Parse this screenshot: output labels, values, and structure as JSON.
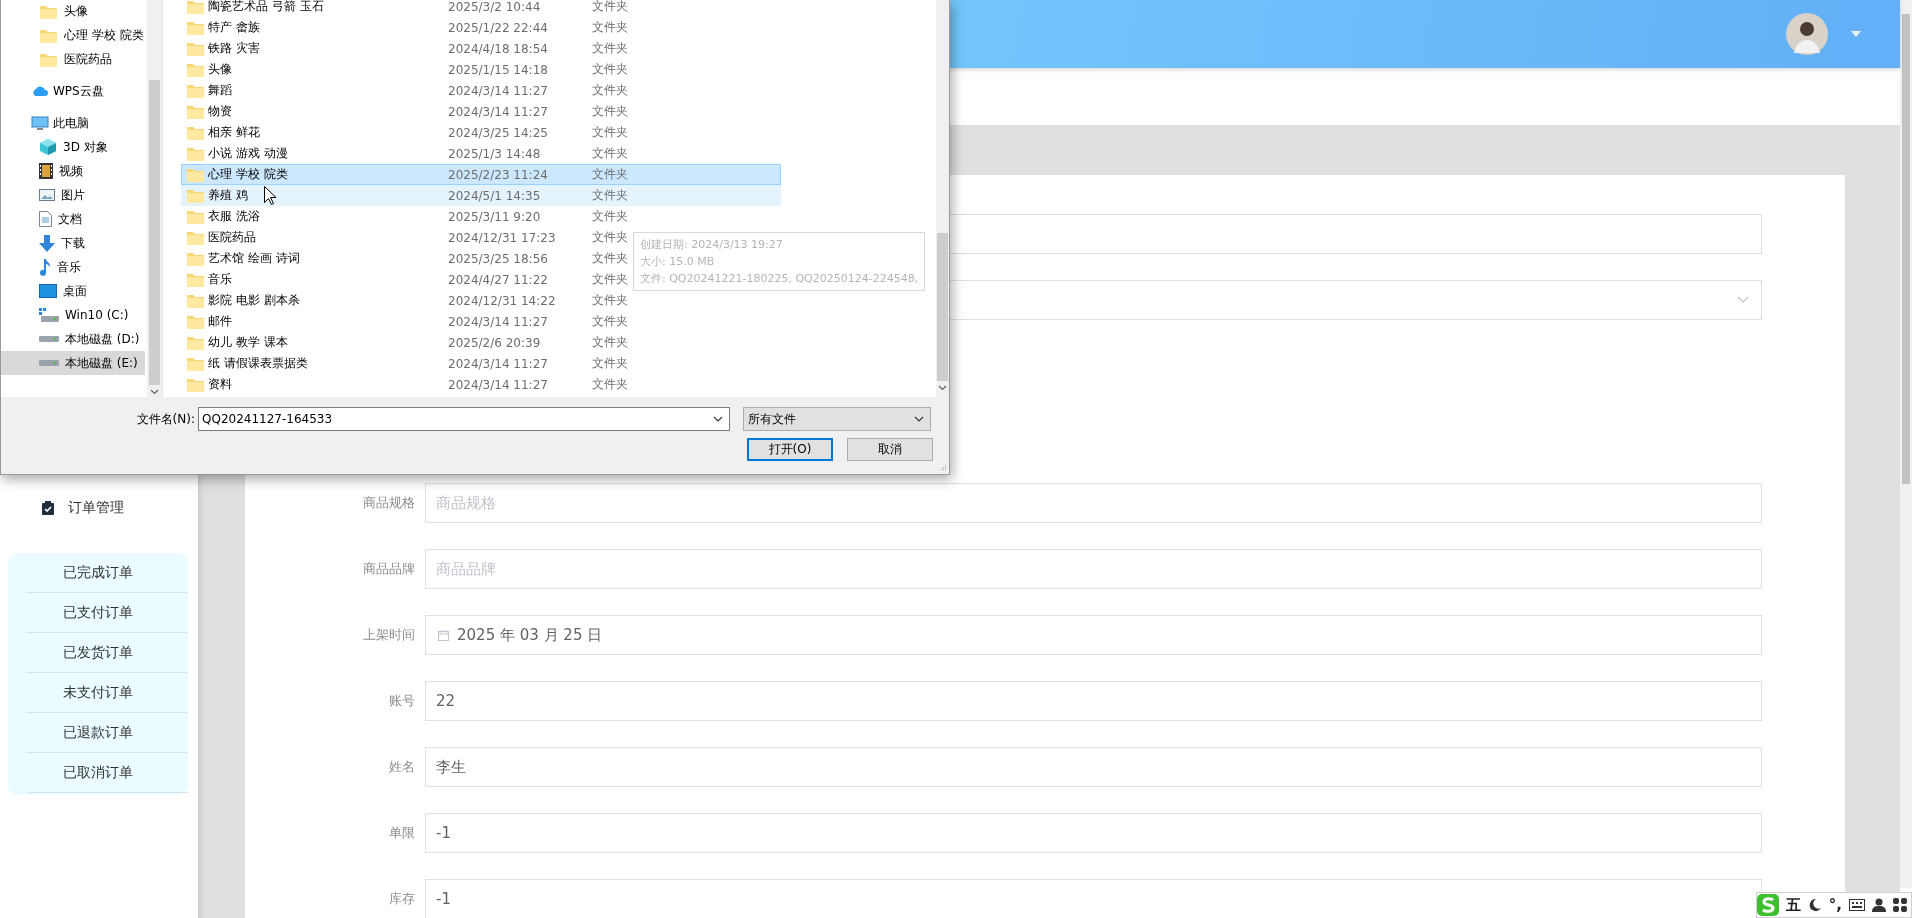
{
  "sidebar": {
    "items": [
      {
        "label": "订单管理",
        "children": [
          {
            "label": "已完成订单"
          },
          {
            "label": "已支付订单"
          },
          {
            "label": "已发货订单"
          },
          {
            "label": "未支付订单"
          },
          {
            "label": "已退款订单"
          },
          {
            "label": "已取消订单"
          }
        ]
      }
    ]
  },
  "form": {
    "fields": [
      {
        "kind": "input"
      },
      {
        "kind": "select"
      },
      {
        "kind": "input",
        "label": "商品规格",
        "placeholder": "商品规格"
      },
      {
        "kind": "input",
        "label": "商品品牌",
        "placeholder": "商品品牌"
      },
      {
        "kind": "date",
        "label": "上架时间",
        "value": "2025 年 03 月 25 日"
      },
      {
        "kind": "input",
        "label": "账号",
        "value": "22"
      },
      {
        "kind": "input",
        "label": "姓名",
        "value": "李生"
      },
      {
        "kind": "input",
        "label": "单限",
        "value": "-1"
      },
      {
        "kind": "input",
        "label": "库存",
        "value": "-1"
      }
    ]
  },
  "file_dialog": {
    "nav": [
      {
        "label": "头像",
        "kind": "folder",
        "selected": false
      },
      {
        "label": "心理 学校 院类",
        "kind": "folder",
        "selected": false
      },
      {
        "label": "医院药品",
        "kind": "folder",
        "selected": false
      },
      {
        "label": "WPS云盘",
        "kind": "cloud",
        "selected": false
      },
      {
        "label": "此电脑",
        "kind": "pc",
        "selected": false,
        "children": [
          {
            "label": "3D 对象",
            "kind": "cube",
            "selected": false
          },
          {
            "label": "视频",
            "kind": "video",
            "selected": false
          },
          {
            "label": "图片",
            "kind": "image",
            "selected": false
          },
          {
            "label": "文档",
            "kind": "document",
            "selected": false
          },
          {
            "label": "下载",
            "kind": "download",
            "selected": false
          },
          {
            "label": "音乐",
            "kind": "music",
            "selected": false
          },
          {
            "label": "桌面",
            "kind": "desktop",
            "selected": false
          },
          {
            "label": "Win10 (C:)",
            "kind": "system-drive",
            "selected": false
          },
          {
            "label": "本地磁盘 (D:)",
            "kind": "drive",
            "selected": false
          },
          {
            "label": "本地磁盘 (E:)",
            "kind": "drive",
            "selected": true
          }
        ]
      }
    ],
    "files": [
      {
        "name": "陶瓷艺术品 弓箭 玉石",
        "modified": "2025/3/2 10:44",
        "type": "文件夹",
        "selected": false,
        "hovered": false
      },
      {
        "name": "特产 畲族",
        "modified": "2025/1/22 22:44",
        "type": "文件夹",
        "selected": false,
        "hovered": false
      },
      {
        "name": "铁路 灾害",
        "modified": "2024/4/18 18:54",
        "type": "文件夹",
        "selected": false,
        "hovered": false
      },
      {
        "name": "头像",
        "modified": "2025/1/15 14:18",
        "type": "文件夹",
        "selected": false,
        "hovered": false
      },
      {
        "name": "舞蹈",
        "modified": "2024/3/14 11:27",
        "type": "文件夹",
        "selected": false,
        "hovered": false
      },
      {
        "name": "物资",
        "modified": "2024/3/14 11:27",
        "type": "文件夹",
        "selected": false,
        "hovered": false
      },
      {
        "name": "相亲 鲜花",
        "modified": "2024/3/25 14:25",
        "type": "文件夹",
        "selected": false,
        "hovered": false
      },
      {
        "name": "小说  游戏  动漫",
        "modified": "2025/1/3 14:48",
        "type": "文件夹",
        "selected": false,
        "hovered": false
      },
      {
        "name": "心理 学校 院类",
        "modified": "2025/2/23 11:24",
        "type": "文件夹",
        "selected": true,
        "hovered": false
      },
      {
        "name": "养殖 鸡",
        "modified": "2024/5/1 14:35",
        "type": "文件夹",
        "selected": false,
        "hovered": true
      },
      {
        "name": "衣服  洗浴",
        "modified": "2025/3/11 9:20",
        "type": "文件夹",
        "selected": false,
        "hovered": false
      },
      {
        "name": "医院药品",
        "modified": "2024/12/31 17:23",
        "type": "文件夹",
        "selected": false,
        "hovered": false
      },
      {
        "name": "艺术馆 绘画 诗词",
        "modified": "2025/3/25 18:56",
        "type": "文件夹",
        "selected": false,
        "hovered": false
      },
      {
        "name": "音乐",
        "modified": "2024/4/27 11:22",
        "type": "文件夹",
        "selected": false,
        "hovered": false
      },
      {
        "name": "影院 电影 剧本杀",
        "modified": "2024/12/31 14:22",
        "type": "文件夹",
        "selected": false,
        "hovered": false
      },
      {
        "name": "邮件",
        "modified": "2024/3/14 11:27",
        "type": "文件夹",
        "selected": false,
        "hovered": false
      },
      {
        "name": "幼儿 教学 课本",
        "modified": "2025/2/6 20:39",
        "type": "文件夹",
        "selected": false,
        "hovered": false
      },
      {
        "name": "纸 请假课表票据类",
        "modified": "2024/3/14 11:27",
        "type": "文件夹",
        "selected": false,
        "hovered": false
      },
      {
        "name": "资料",
        "modified": "2024/3/14 11:27",
        "type": "文件夹",
        "selected": false,
        "hovered": false
      }
    ],
    "tooltip": [
      "创建日期: 2024/3/13 19:27",
      "大小: 15.0 MB",
      "文件: QQ20241221-180225, QQ20250124-224548,"
    ],
    "filename_label": "文件名(N):",
    "filename": "QQ20241127-164533",
    "filetype": "所有文件",
    "buttons": [
      {
        "label": "打开(O)",
        "default": true
      },
      {
        "label": "取消",
        "default": false
      }
    ]
  },
  "ime_toolbar": {
    "mode": "五",
    "punctuation": "°,"
  }
}
